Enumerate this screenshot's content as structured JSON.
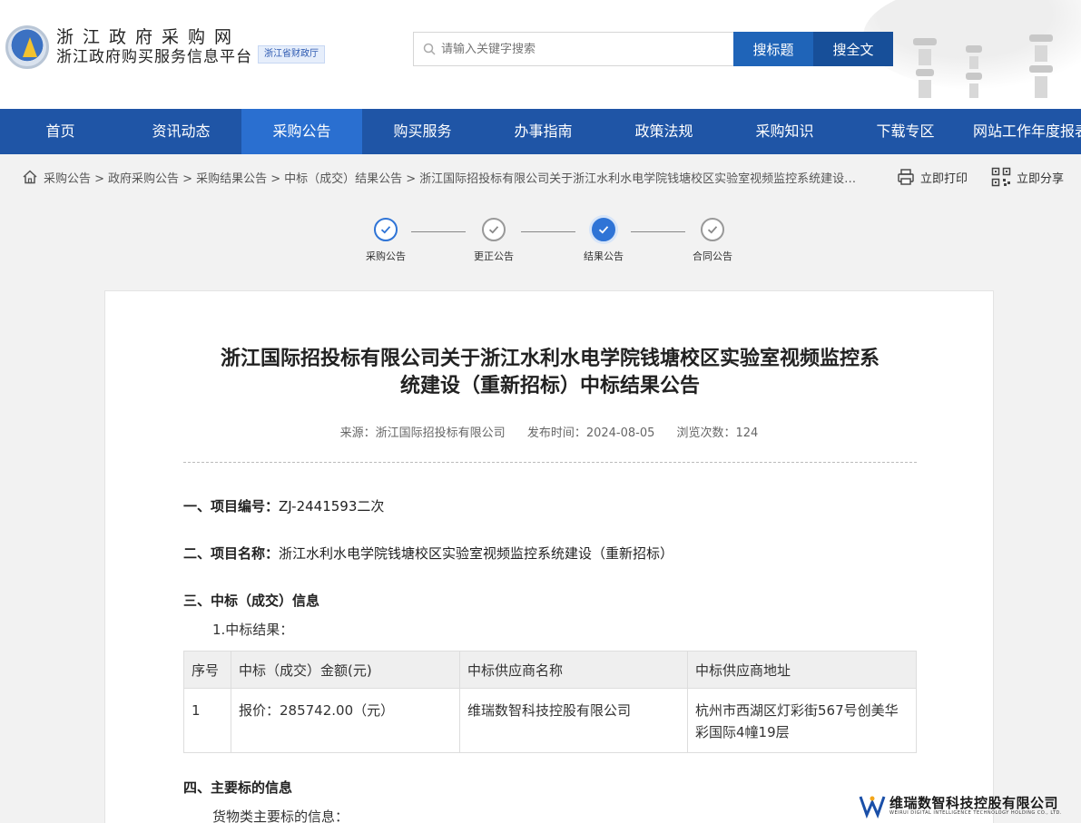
{
  "header": {
    "logo_line1": "浙江政府采购网",
    "logo_line2": "浙江政府购买服务信息平台",
    "logo_tag": "浙江省财政厅",
    "search_placeholder": "请输入关键字搜索",
    "search_title_btn": "搜标题",
    "search_full_btn": "搜全文"
  },
  "nav": {
    "items": [
      "首页",
      "资讯动态",
      "采购公告",
      "购买服务",
      "办事指南",
      "政策法规",
      "采购知识",
      "下载专区",
      "网站工作年度报表"
    ],
    "active_index": 2
  },
  "breadcrumb": {
    "items": [
      "采购公告 >",
      "政府采购公告 >",
      "采购结果公告 >",
      "中标（成交）结果公告 >"
    ],
    "current": "浙江国际招投标有限公司关于浙江水利水电学院钱塘校区实验室视频监控系统建设（重新招标）中标结果公告"
  },
  "tools": {
    "print": "立即打印",
    "share": "立即分享"
  },
  "steps": [
    {
      "label": "采购公告",
      "state": "done"
    },
    {
      "label": "更正公告",
      "state": "gray"
    },
    {
      "label": "结果公告",
      "state": "current"
    },
    {
      "label": "合同公告",
      "state": "gray"
    }
  ],
  "article": {
    "title_line1": "浙江国际招投标有限公司关于浙江水利水电学院钱塘校区实验室视频监控系",
    "title_line2": "统建设（重新招标）中标结果公告",
    "meta": {
      "source": "来源：浙江国际招投标有限公司",
      "publish": "发布时间：2024-08-05",
      "views": "浏览次数：124"
    },
    "s1_label": "一、项目编号：",
    "s1_value": "ZJ-2441593二次",
    "s2_label": "二、项目名称：",
    "s2_value": "浙江水利水电学院钱塘校区实验室视频监控系统建设（重新招标）",
    "s3_label": "三、中标（成交）信息",
    "s3_sub": "1.中标结果：",
    "table": {
      "headers": [
        "序号",
        "中标（成交）金额(元)",
        "中标供应商名称",
        "中标供应商地址"
      ],
      "rows": [
        [
          "1",
          "报价：285742.00（元）",
          "维瑞数智科技控股有限公司",
          "杭州市西湖区灯彩街567号创美华彩国际4幢19层"
        ]
      ]
    },
    "s4_label": "四、主要标的信息",
    "s4_sub": "货物类主要标的信息："
  },
  "watermark": {
    "cn": "维瑞数智科技控股有限公司",
    "en": "WEIRUI DIGITAL INTELLIGENCE TECHNOLOGY HOLDING CO., LTD."
  }
}
